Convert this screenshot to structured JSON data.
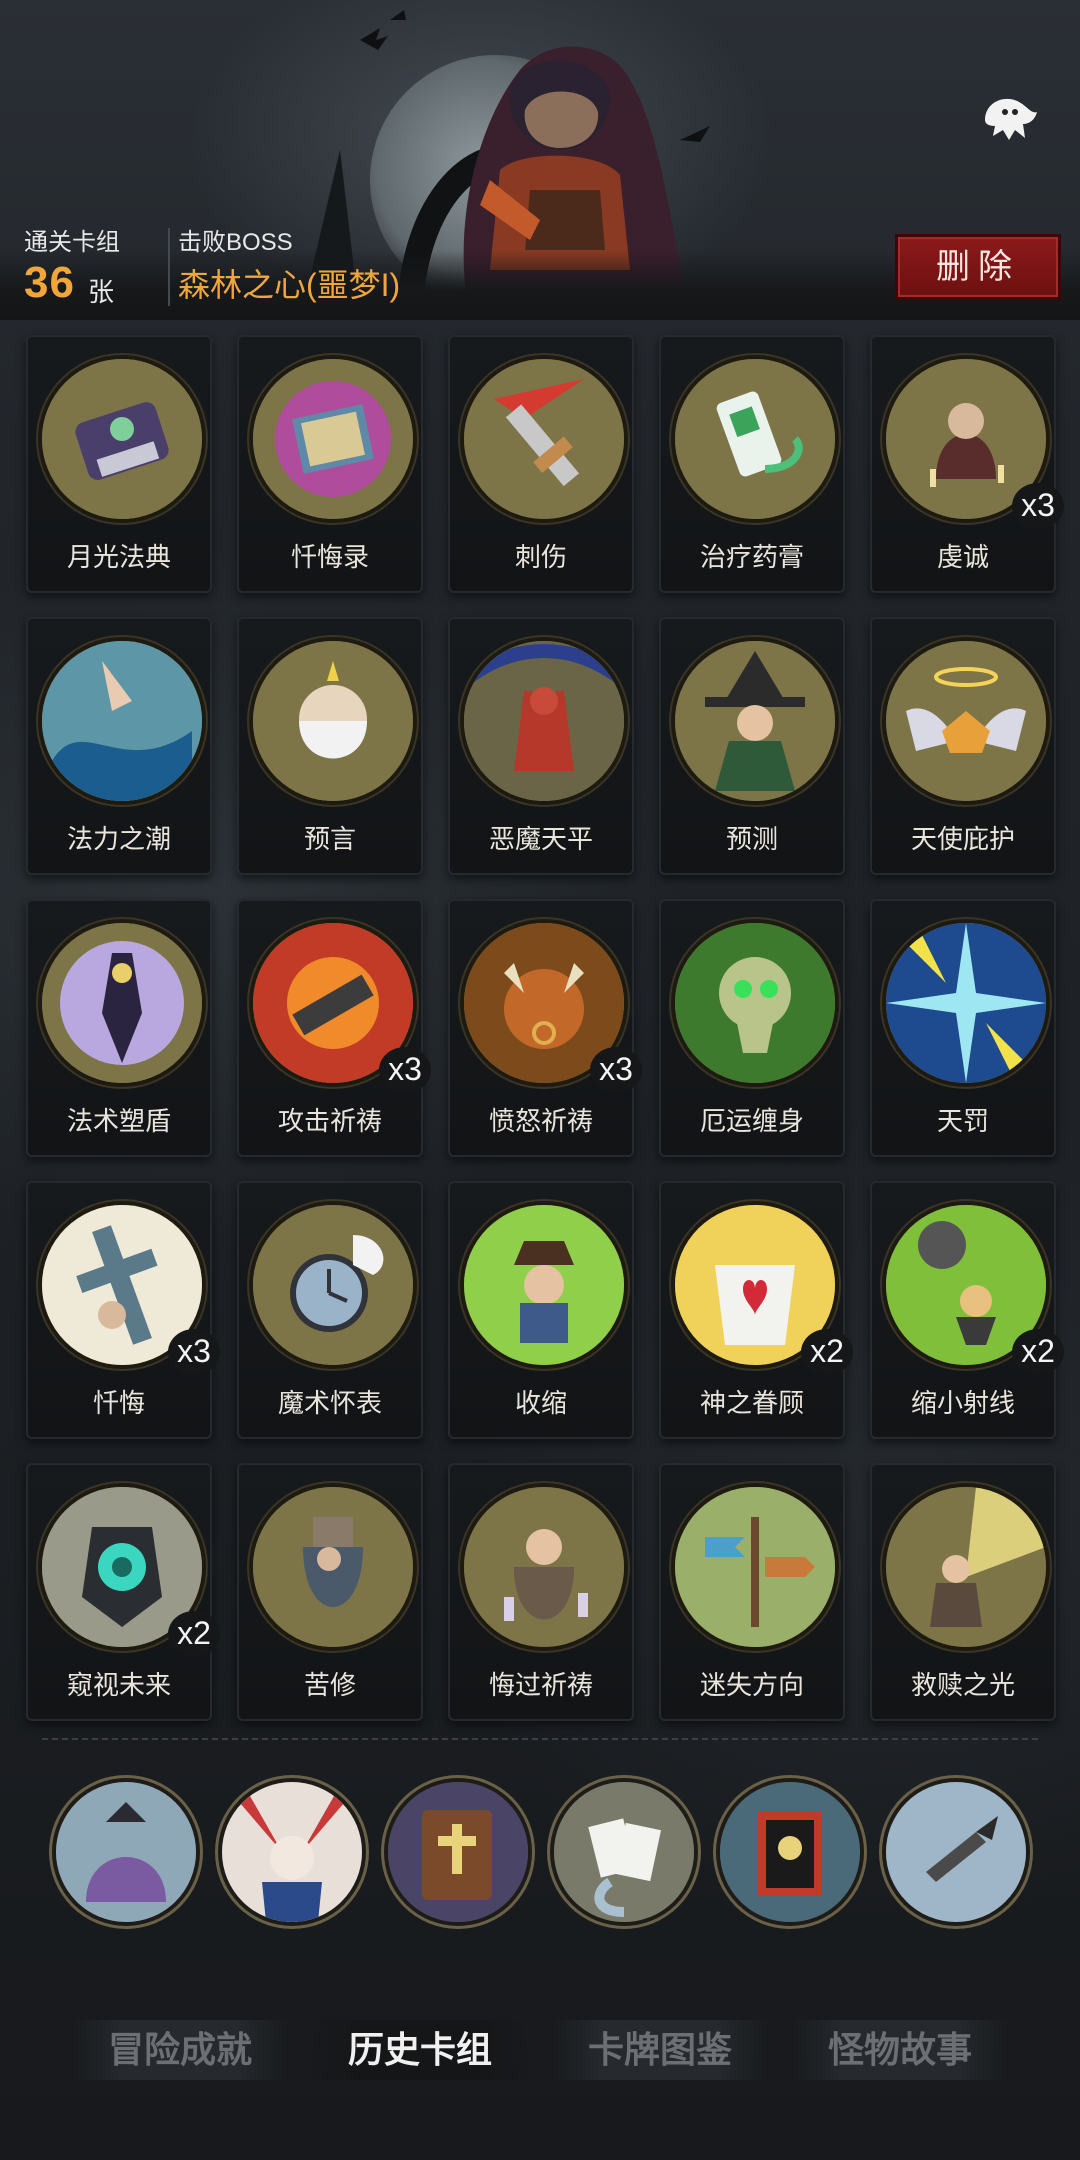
{
  "header": {
    "deck_label": "通关卡组",
    "deck_count": "36",
    "deck_unit": "张",
    "boss_label": "击败BOSS",
    "boss_name": "森林之心(噩梦I)",
    "delete_label": "删除"
  },
  "cards": [
    {
      "name": "月光法典",
      "icon": "moonlight-codex-icon",
      "count": ""
    },
    {
      "name": "忏悔录",
      "icon": "confession-book-icon",
      "count": ""
    },
    {
      "name": "刺伤",
      "icon": "stab-dagger-icon",
      "count": ""
    },
    {
      "name": "治疗药膏",
      "icon": "healing-ointment-icon",
      "count": ""
    },
    {
      "name": "虔诚",
      "icon": "piety-praying-icon",
      "count": "x3"
    },
    {
      "name": "法力之潮",
      "icon": "mana-tide-icon",
      "count": ""
    },
    {
      "name": "预言",
      "icon": "prophecy-elder-icon",
      "count": ""
    },
    {
      "name": "恶魔天平",
      "icon": "demon-scale-icon",
      "count": ""
    },
    {
      "name": "预测",
      "icon": "witch-prediction-icon",
      "count": ""
    },
    {
      "name": "天使庇护",
      "icon": "angel-protection-icon",
      "count": ""
    },
    {
      "name": "法术塑盾",
      "icon": "spell-shield-icon",
      "count": ""
    },
    {
      "name": "攻击祈祷",
      "icon": "attack-prayer-icon",
      "count": "x3"
    },
    {
      "name": "愤怒祈祷",
      "icon": "rage-prayer-icon",
      "count": "x3"
    },
    {
      "name": "厄运缠身",
      "icon": "doom-skull-icon",
      "count": ""
    },
    {
      "name": "天罚",
      "icon": "divine-punishment-icon",
      "count": ""
    },
    {
      "name": "忏悔",
      "icon": "repentance-cross-icon",
      "count": "x3"
    },
    {
      "name": "魔术怀表",
      "icon": "magic-pocket-watch-icon",
      "count": ""
    },
    {
      "name": "收缩",
      "icon": "shrink-icon",
      "count": ""
    },
    {
      "name": "神之眷顾",
      "icon": "divine-favor-angel-icon",
      "count": "x2"
    },
    {
      "name": "缩小射线",
      "icon": "shrink-ray-icon",
      "count": "x2"
    },
    {
      "name": "窥视未来",
      "icon": "peek-future-icon",
      "count": "x2"
    },
    {
      "name": "苦修",
      "icon": "ascetic-icon",
      "count": ""
    },
    {
      "name": "悔过祈祷",
      "icon": "repentance-prayer-icon",
      "count": ""
    },
    {
      "name": "迷失方向",
      "icon": "lost-signpost-icon",
      "count": ""
    },
    {
      "name": "救赎之光",
      "icon": "redemption-light-icon",
      "count": ""
    }
  ],
  "relics": [
    {
      "icon": "tentacle-monster-icon"
    },
    {
      "icon": "bunny-girl-icon"
    },
    {
      "icon": "holy-bible-icon"
    },
    {
      "icon": "poker-cards-icon"
    },
    {
      "icon": "pirate-card-icon"
    },
    {
      "icon": "broken-dagger-icon"
    }
  ],
  "tabs": [
    {
      "label": "冒险成就",
      "active": false
    },
    {
      "label": "历史卡组",
      "active": true
    },
    {
      "label": "卡牌图鉴",
      "active": false
    },
    {
      "label": "怪物故事",
      "active": false
    }
  ],
  "colors": {
    "accent_orange": "#f0a63a",
    "delete_red": "#8c1a1a",
    "card_ring_olive": "#7d7548"
  }
}
